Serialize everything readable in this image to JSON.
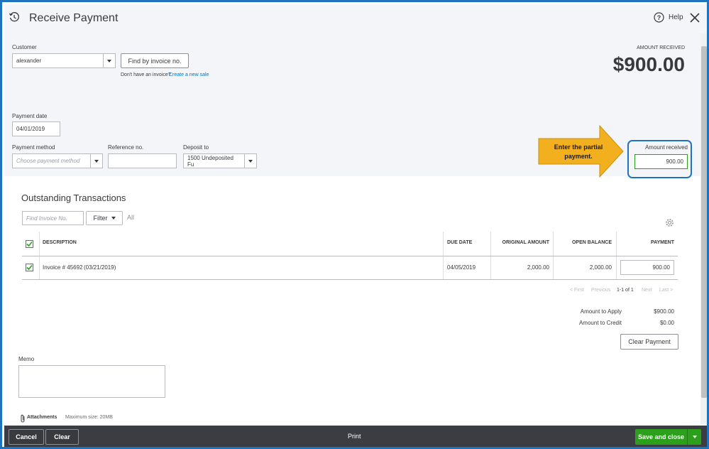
{
  "header": {
    "title": "Receive Payment",
    "help_label": "Help"
  },
  "customer": {
    "label": "Customer",
    "value": "alexander",
    "find_button": "Find by invoice no.",
    "no_invoice_text": "Don't have an invoice?",
    "create_sale_link": "Create a new sale"
  },
  "amount_received_summary": {
    "label": "AMOUNT RECEIVED",
    "value": "$900.00"
  },
  "payment_date": {
    "label": "Payment date",
    "value": "04/01/2019"
  },
  "payment_method": {
    "label": "Payment method",
    "placeholder": "Choose payment method"
  },
  "reference": {
    "label": "Reference no.",
    "value": ""
  },
  "deposit_to": {
    "label": "Deposit to",
    "value": "1500 Undeposited Fu"
  },
  "callout": {
    "text": "Enter the partial payment.",
    "color": "#f2b01e"
  },
  "amount_received_field": {
    "label": "Amount received",
    "value": "900.00",
    "highlight_color": "#1e73be"
  },
  "outstanding": {
    "title": "Outstanding Transactions",
    "find_placeholder": "Find Invoice No.",
    "filter_label": "Filter",
    "all_label": "All",
    "columns": [
      "DESCRIPTION",
      "DUE DATE",
      "ORIGINAL AMOUNT",
      "OPEN BALANCE",
      "PAYMENT"
    ],
    "rows": [
      {
        "checked": true,
        "invoice_link": "Invoice # 45692",
        "invoice_date": "(03/21/2019)",
        "due_date": "04/05/2019",
        "original_amount": "2,000.00",
        "open_balance": "2,000.00",
        "payment": "900.00"
      }
    ],
    "pagination": {
      "first": "< First",
      "previous": "Previous",
      "range": "1-1 of 1",
      "next": "Next",
      "last": "Last >"
    }
  },
  "totals": {
    "apply_label": "Amount to Apply",
    "apply_value": "$900.00",
    "credit_label": "Amount to Credit",
    "credit_value": "$0.00",
    "clear_payment_button": "Clear Payment"
  },
  "memo": {
    "label": "Memo",
    "value": ""
  },
  "attachments": {
    "label": "Attachments",
    "max_size": "Maximum size: 20MB"
  },
  "footer": {
    "cancel": "Cancel",
    "clear": "Clear",
    "print": "Print",
    "save_close": "Save and close",
    "save_color": "#2ca01c"
  }
}
